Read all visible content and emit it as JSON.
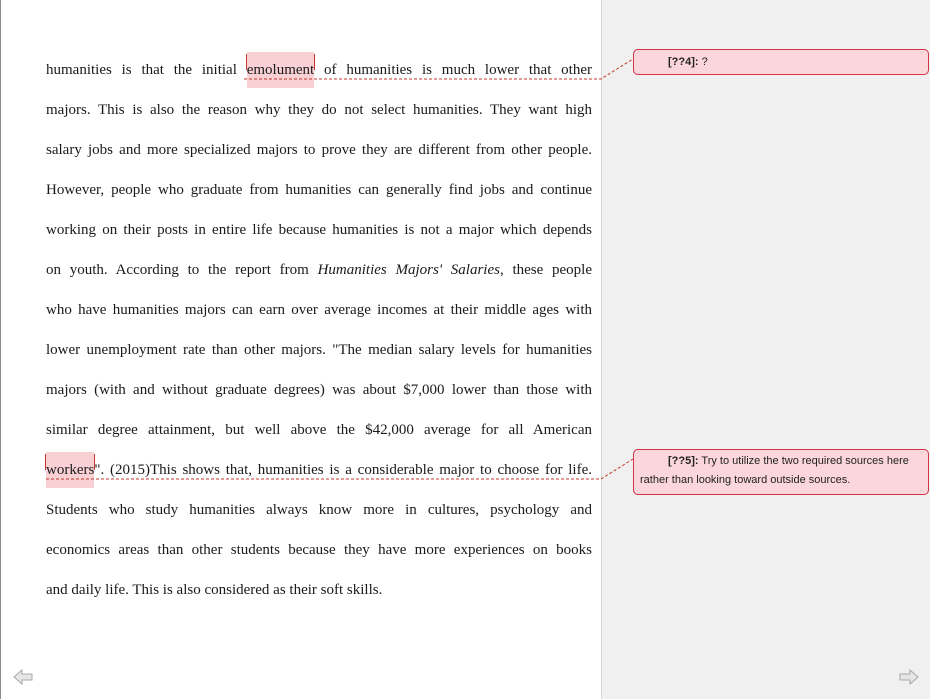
{
  "document": {
    "lines": [
      {
        "pre": "humanities is that the initial ",
        "hl": "emolument",
        "post": " of humanities is much lower that other"
      },
      {
        "text": "majors. This is also the reason why they do not select humanities. They want high"
      },
      {
        "text": "salary jobs and more specialized majors to prove they are different from other people."
      },
      {
        "text": "However, people who graduate from humanities can generally find jobs and continue"
      },
      {
        "text": "working on their posts in entire life because humanities is not a major which depends"
      },
      {
        "pre": "on youth. According to the report from ",
        "italic": "Humanities Majors' Salaries",
        "post": ", these people"
      },
      {
        "text": "who have humanities majors can earn over average incomes at their middle ages with"
      },
      {
        "text": "lower unemployment rate than other majors. \"The median salary levels for humanities"
      },
      {
        "text": "majors (with and without graduate degrees) was about $7,000 lower than those with"
      },
      {
        "text": "similar degree attainment, but well above the $42,000 average for all American"
      },
      {
        "hl": "workers",
        "post": "\". (2015)This shows that, humanities is a considerable major to choose for life."
      },
      {
        "text": "Students who study humanities always know more in cultures, psychology and"
      },
      {
        "text": "economics areas than other students because they have more experiences on books"
      },
      {
        "text": "and daily life. This is also considered as their soft skills."
      }
    ]
  },
  "comments": [
    {
      "tag": "[??4]:",
      "text": " ?"
    },
    {
      "tag": "[??5]:",
      "text": " Try to utilize the two required sources here rather than looking toward outside sources."
    }
  ],
  "colors": {
    "highlight": "#f9d0d4",
    "comment_border": "#d5334a",
    "comment_fill": "#fbd6da",
    "margin_pane": "#f0f0f0"
  },
  "icons": {
    "prev": "left-arrow-icon",
    "next": "right-arrow-icon"
  }
}
